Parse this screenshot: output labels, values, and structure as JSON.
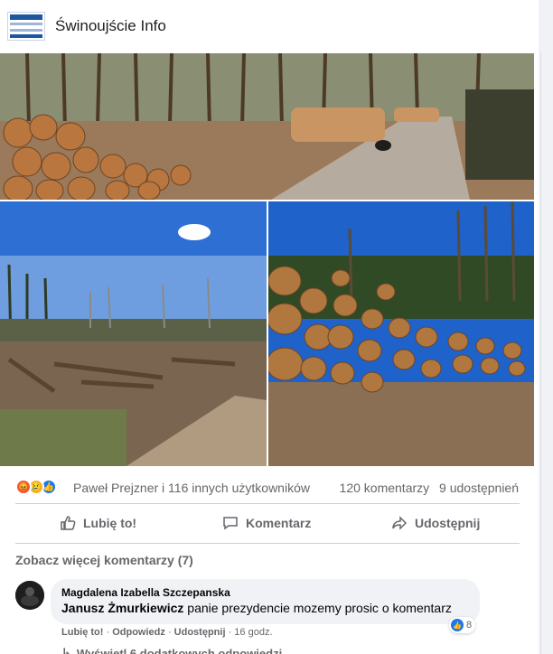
{
  "post": {
    "page_name": "Świnoujście Info",
    "page_logo_icon": "page-logo-icon"
  },
  "photos": [
    {
      "name": "photo-logs-along-forest-road"
    },
    {
      "name": "photo-clearcut-area"
    },
    {
      "name": "photo-log-pile"
    }
  ],
  "reactions": {
    "icons": [
      "angry-reaction-icon",
      "sad-reaction-icon",
      "like-reaction-icon"
    ],
    "summary": "Paweł Prejzner i 116 innych użytkowników",
    "comments_count": "120 komentarzy",
    "shares_count": "9 udostępnień"
  },
  "actions": {
    "like": "Lubię to!",
    "comment": "Komentarz",
    "share": "Udostępnij"
  },
  "comments": {
    "more_label": "Zobacz więcej komentarzy (7)",
    "items": [
      {
        "author": "Magdalena Izabella Szczepanska",
        "mention": "Janusz Żmurkiewicz",
        "text": "panie prezydencie mozemy prosic o komentarz",
        "reaction_count": "8",
        "like_label": "Lubię to!",
        "reply_label": "Odpowiedz",
        "share_label": "Udostępnij",
        "time": "16 godz.",
        "replies_label": "Wyświetl 6 dodatkowych odpowiedzi"
      }
    ]
  },
  "colors": {
    "accent": "#1877f2",
    "secondary_text": "#65676b",
    "angry": "#f0563d",
    "sad": "#f7b125"
  }
}
